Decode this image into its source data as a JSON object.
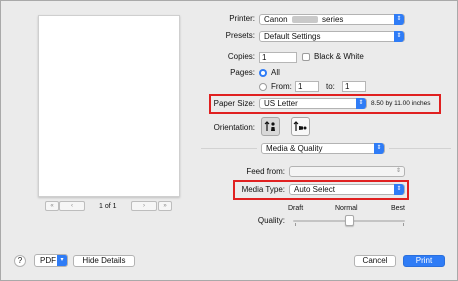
{
  "preview": {
    "page_counter": "1 of 1"
  },
  "printer": {
    "label": "Printer:",
    "value_prefix": "Canon",
    "value_suffix": "series"
  },
  "presets": {
    "label": "Presets:",
    "value": "Default Settings"
  },
  "copies": {
    "label": "Copies:",
    "value": "1",
    "bw_label": "Black & White",
    "bw_checked": false
  },
  "pages": {
    "label": "Pages:",
    "all_label": "All",
    "from_label": "From:",
    "from_value": "1",
    "to_label": "to:",
    "to_value": "1",
    "selected": "All"
  },
  "paper_size": {
    "label": "Paper Size:",
    "value": "US Letter",
    "dimensions": "8.50 by 11.00 inches"
  },
  "orientation": {
    "label": "Orientation:",
    "selected": "portrait"
  },
  "section": {
    "value": "Media & Quality"
  },
  "feed_from": {
    "label": "Feed from:",
    "value": ""
  },
  "media_type": {
    "label": "Media Type:",
    "value": "Auto Select"
  },
  "quality": {
    "label": "Quality:",
    "draft": "Draft",
    "normal": "Normal",
    "best": "Best",
    "level": 0.5
  },
  "footer": {
    "help": "?",
    "pdf": "PDF",
    "hide_details": "Hide Details",
    "cancel": "Cancel",
    "print": "Print"
  },
  "colors": {
    "accent": "#2f7cf6",
    "highlight_box": "#e02020"
  }
}
